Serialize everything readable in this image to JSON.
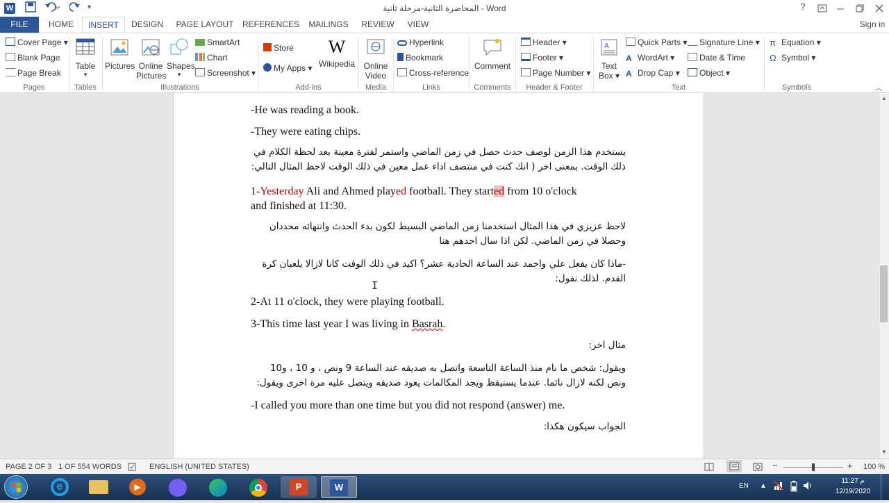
{
  "window": {
    "title": "المحاضرة الثانية-مرحلة ثانية - Word",
    "help": "?",
    "sign_in": "Sign in"
  },
  "tabs": [
    "FILE",
    "HOME",
    "INSERT",
    "DESIGN",
    "PAGE LAYOUT",
    "REFERENCES",
    "MAILINGS",
    "REVIEW",
    "VIEW"
  ],
  "active_tab": "INSERT",
  "ribbon": {
    "pages": {
      "cover_page": "Cover Page",
      "blank_page": "Blank Page",
      "page_break": "Page Break",
      "label": "Pages"
    },
    "tables": {
      "table": "Table",
      "label": "Tables"
    },
    "illustrations": {
      "pictures": "Pictures",
      "online_pictures_1": "Online",
      "online_pictures_2": "Pictures",
      "shapes": "Shapes",
      "smartart": "SmartArt",
      "chart": "Chart",
      "screenshot": "Screenshot",
      "label": "Illustrations"
    },
    "addins": {
      "store": "Store",
      "my_apps": "My Apps",
      "wikipedia": "Wikipedia",
      "label": "Add-ins"
    },
    "media": {
      "online_video_1": "Online",
      "online_video_2": "Video",
      "label": "Media"
    },
    "links": {
      "hyperlink": "Hyperlink",
      "bookmark": "Bookmark",
      "cross_reference": "Cross-reference",
      "label": "Links"
    },
    "comments": {
      "comment": "Comment",
      "label": "Comments"
    },
    "header_footer": {
      "header": "Header",
      "footer": "Footer",
      "page_number": "Page Number",
      "label": "Header & Footer"
    },
    "text": {
      "text_box_1": "Text",
      "text_box_2": "Box",
      "quick_parts": "Quick Parts",
      "wordart": "WordArt",
      "drop_cap": "Drop Cap",
      "signature_line": "Signature Line",
      "date_time": "Date & Time",
      "object": "Object",
      "label": "Text"
    },
    "symbols": {
      "equation": "Equation",
      "symbol": "Symbol",
      "label": "Symbols"
    }
  },
  "document": {
    "l1": "-He was reading a book.",
    "l2": "-They were eating chips.",
    "ar1a": "يستخدم هذا الزمن لوصف حدث حصل في زمن الماضي واستمر لفترة معينة بعد لحظة الكلام في",
    "ar1b": "ذلك الوقت. بمعنى اخر ( انك كنت في منتصف اداء عمل معين في ذلك الوقت لاحظ المثال التالي:",
    "ex1_num": "1-",
    "ex1_yesterday": "Yesterday",
    "ex1_mid": " Ali and Ahmed play",
    "ex1_ed1": "ed",
    "ex1_mid2": " football. They start",
    "ex1_ed2": "ed",
    "ex1_end": " from 10 o'clock",
    "ex1_line2": "and finished at 11:30.",
    "ar2a": "لاحظ عزيزي في هذا المثال استخدمنا زمن الماضي البسيط لكون بدء الحدث وانتهائه محددان",
    "ar2b": "وحصلا في زمن الماضي. لكن اذا سال احدهم هنا",
    "ar3a": "-ماذا كان يفعل علي واحمد عند الساعة الحادية عشر؟ اكيد في ذلك الوقت كانا لازالا يلعبان كرة",
    "ar3b": "القدم. لذلك نقول:",
    "ex2": "2-At 11 o'clock, they were playing football.",
    "ex3_a": "3-This time last year I was living in ",
    "ex3_b": "Basrah",
    "ex3_c": ".",
    "ar4": "مثال اخر:",
    "ar5a": "ويقول: شخص ما نام منذ الساعة التاسعة واتصل به صديقه عند الساعة 9 ونص ، و 10 ، و10",
    "ar5b": "ونص لكنه لازال نائما. عندما يستيقظ ويجد المكالمات يعود صديقه ويتصل عليه مرة اخرى ويقول:",
    "ex4": "-I called you more than one time but you did not respond (answer) me.",
    "ar6": "الجواب سيكون هكذا:"
  },
  "status": {
    "page": "PAGE 2 OF 3",
    "words": "1 OF 554 WORDS",
    "language": "ENGLISH (UNITED STATES)",
    "zoom": "100 %",
    "zoom_level": 1.0
  },
  "taskbar": {
    "lang": "EN",
    "time": "11:27 م",
    "date": "12/19/2020"
  },
  "colors": {
    "accent": "#2b579a",
    "red_text": "#c00000",
    "taskbar": "#1f3a5c"
  }
}
